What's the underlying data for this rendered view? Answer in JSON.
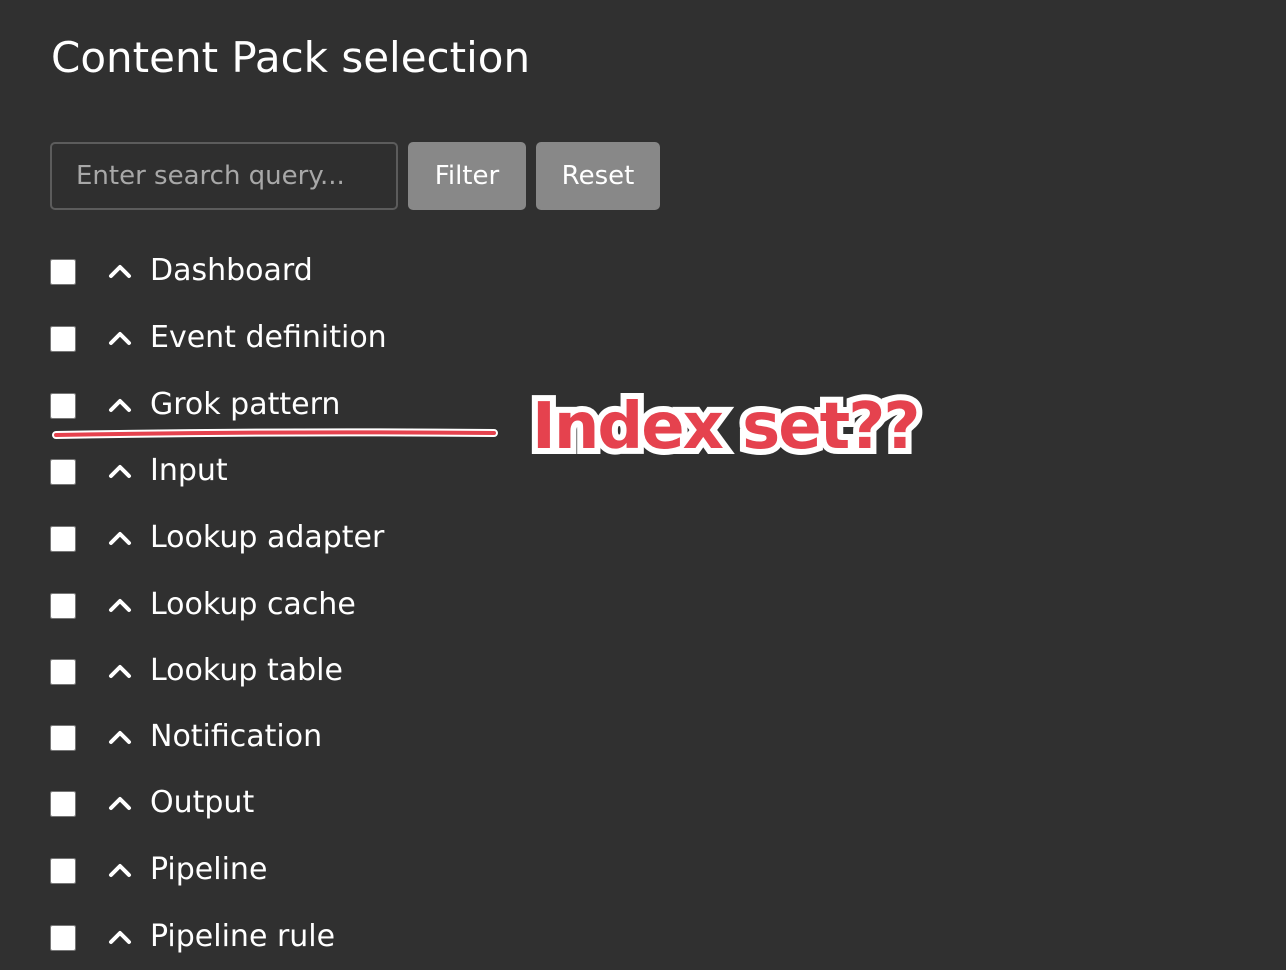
{
  "page": {
    "title": "Content Pack selection"
  },
  "search": {
    "placeholder": "Enter search query...",
    "value": "",
    "filter_label": "Filter",
    "reset_label": "Reset"
  },
  "list": {
    "items": [
      {
        "label": "Dashboard",
        "checked": false,
        "expand_icon": "chevron-up-icon"
      },
      {
        "label": "Event definition",
        "checked": false,
        "expand_icon": "chevron-up-icon"
      },
      {
        "label": "Grok pattern",
        "checked": false,
        "expand_icon": "chevron-up-icon"
      },
      {
        "label": "Input",
        "checked": false,
        "expand_icon": "chevron-up-icon"
      },
      {
        "label": "Lookup adapter",
        "checked": false,
        "expand_icon": "chevron-up-icon"
      },
      {
        "label": "Lookup cache",
        "checked": false,
        "expand_icon": "chevron-up-icon"
      },
      {
        "label": "Lookup table",
        "checked": false,
        "expand_icon": "chevron-up-icon"
      },
      {
        "label": "Notification",
        "checked": false,
        "expand_icon": "chevron-up-icon"
      },
      {
        "label": "Output",
        "checked": false,
        "expand_icon": "chevron-up-icon"
      },
      {
        "label": "Pipeline",
        "checked": false,
        "expand_icon": "chevron-up-icon"
      },
      {
        "label": "Pipeline rule",
        "checked": false,
        "expand_icon": "chevron-up-icon"
      }
    ]
  },
  "annotation": {
    "text": "Index set??",
    "color": "#e5424e",
    "outline_color": "#ffffff"
  },
  "colors": {
    "background": "#303030",
    "button": "#888888",
    "text": "#ffffff"
  }
}
